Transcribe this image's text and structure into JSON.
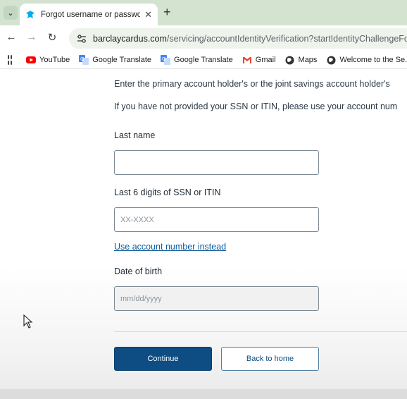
{
  "browser": {
    "tab": {
      "title": "Forgot username or password",
      "favicon": "barclays-eagle-icon"
    },
    "url": {
      "host": "barclaycardus.com",
      "path": "/servicing/accountIdentityVerification?startIdentityChallengeForRes"
    },
    "bookmarks": [
      {
        "label": "YouTube",
        "icon": "youtube-icon",
        "color": "#ff0000"
      },
      {
        "label": "Google Translate",
        "icon": "translate-icon",
        "color": "#4285f4"
      },
      {
        "label": "Google Translate",
        "icon": "translate-icon",
        "color": "#4285f4"
      },
      {
        "label": "Gmail",
        "icon": "gmail-icon",
        "color": "#ea4335"
      },
      {
        "label": "Maps",
        "icon": "globe-icon",
        "color": "#333333"
      },
      {
        "label": "Welcome to the Se...",
        "icon": "globe-icon",
        "color": "#333333"
      }
    ]
  },
  "form": {
    "intro_line1": "Enter the primary account holder's or the joint savings account holder's",
    "intro_line2": "If you have not provided your SSN or ITIN, please use your account num",
    "last_name_label": "Last name",
    "last_name_value": "",
    "ssn_label": "Last 6 digits of SSN or ITIN",
    "ssn_placeholder": "XX-XXXX",
    "use_account_link": "Use account number instead",
    "dob_label": "Date of birth",
    "dob_placeholder": "mm/dd/yyyy",
    "continue_label": "Continue",
    "back_label": "Back to home"
  },
  "colors": {
    "primary": "#0d4d84",
    "link": "#0d5c9c",
    "tabstrip": "#d3e3d0"
  }
}
